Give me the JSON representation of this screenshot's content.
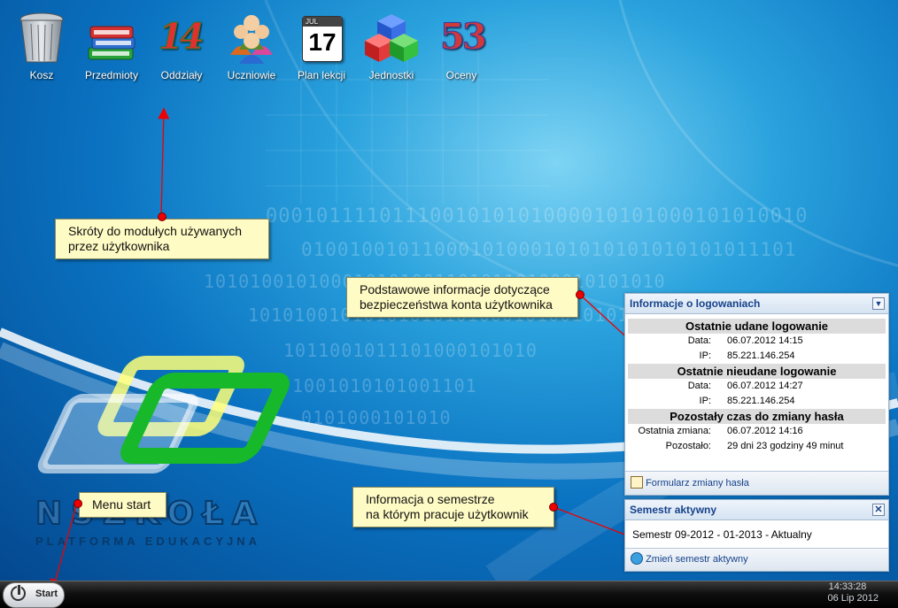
{
  "desktop_icons": [
    {
      "label": "Kosz",
      "icon": "trash-icon"
    },
    {
      "label": "Przedmioty",
      "icon": "books-icon"
    },
    {
      "label": "Oddziały",
      "icon": "numbers-icon"
    },
    {
      "label": "Uczniowie",
      "icon": "students-icon"
    },
    {
      "label": "Plan lekcji",
      "icon": "calendar-icon"
    },
    {
      "label": "Jednostki",
      "icon": "cubes-icon"
    },
    {
      "label": "Oceny",
      "icon": "grades-icon"
    }
  ],
  "calendar_icon": {
    "month": "JUL",
    "day": "17"
  },
  "numbers_icon_text": "14",
  "grades_icon_text": "53",
  "callouts": {
    "shortcuts": "Skróty do modułych używanych\nprzez użytkownika",
    "security": "Podstawowe informacje dotyczące\nbezpieczeństwa konta użytkownika",
    "start": "Menu start",
    "semester": "Informacja o semestrze\nna którym pracuje użytkownik"
  },
  "login_panel": {
    "title": "Informacje o logowaniach",
    "success_title": "Ostatnie udane logowanie",
    "success_date_label": "Data:",
    "success_date": "06.07.2012 14:15",
    "success_ip_label": "IP:",
    "success_ip": "85.221.146.254",
    "fail_title": "Ostatnie nieudane logowanie",
    "fail_date_label": "Data:",
    "fail_date": "06.07.2012 14:27",
    "fail_ip_label": "IP:",
    "fail_ip": "85.221.146.254",
    "pwd_title": "Pozostały czas do zmiany hasła",
    "last_change_label": "Ostatnia zmiana:",
    "last_change": "06.07.2012 14:16",
    "remaining_label": "Pozostało:",
    "remaining": "29 dni 23 godziny 49 minut",
    "footer_link": "Formularz zmiany hasła"
  },
  "semester_panel": {
    "title": "Semestr aktywny",
    "value": "Semestr 09-2012 - 01-2013 - Aktualny",
    "footer_link": "Zmień semestr aktywny"
  },
  "logo": {
    "line1": "NSZKOŁA",
    "line2": "PLATFORMA EDUKACYJNA"
  },
  "taskbar": {
    "start_label": "Start",
    "time": "14:33:28",
    "date": "06 Lip 2012"
  },
  "binary_lines": [
    "0001011110111001010101000010101000101010010",
    "01001001011000101000101010101010101011101",
    "1010100101000101010011010110100010101010",
    "10101001010101010101000101001010101",
    "1011001011101000101010",
    "1001010101001101",
    "0101000101010"
  ],
  "colors": {
    "accent": "#15428b",
    "callout_bg": "#fffbc4",
    "pointer": "#e00000"
  }
}
